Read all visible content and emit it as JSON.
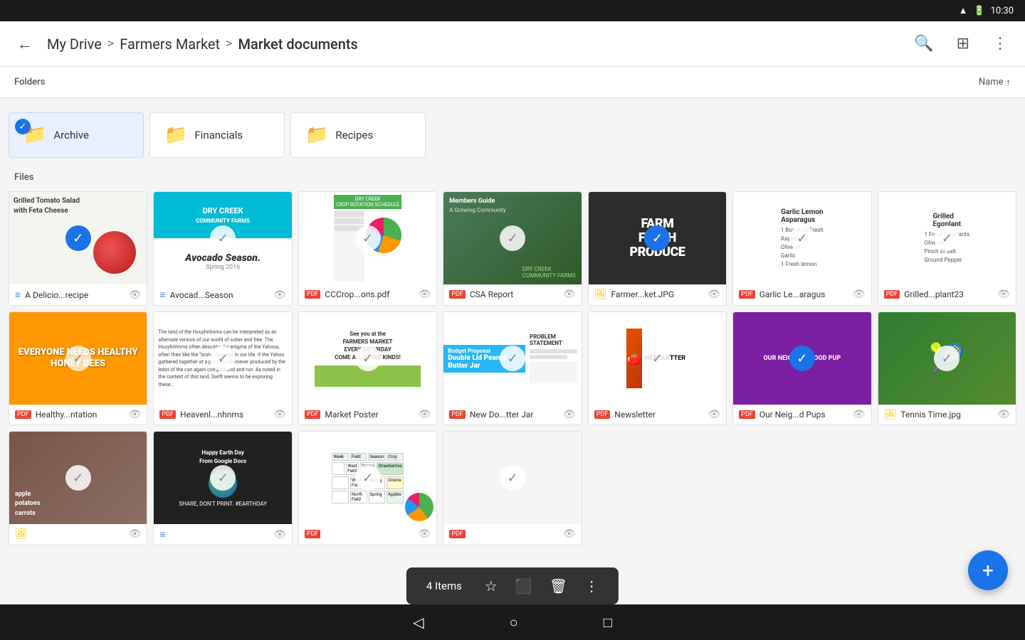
{
  "statusBar": {
    "time": "10:30",
    "wifi": "wifi",
    "battery": "battery"
  },
  "nav": {
    "backLabel": "←",
    "breadcrumb": {
      "part1": "My Drive",
      "sep1": ">",
      "part2": "Farmers Market",
      "sep2": ">",
      "part3": "Market documents"
    },
    "searchIcon": "search",
    "gridIcon": "grid",
    "moreIcon": "⋮"
  },
  "sortBar": {
    "foldersLabel": "Folders",
    "nameLabel": "Name",
    "sortArrow": "↑"
  },
  "folders": [
    {
      "id": "archive",
      "name": "Archive",
      "icon": "📁",
      "color": "#1a73e8",
      "selected": true
    },
    {
      "id": "financials",
      "name": "Financials",
      "icon": "📁",
      "color": "#f9a825",
      "selected": false
    },
    {
      "id": "recipes",
      "name": "Recipes",
      "icon": "📁",
      "color": "#8e24aa",
      "selected": false
    }
  ],
  "filesSection": {
    "label": "Files"
  },
  "files": [
    {
      "id": "file1",
      "name": "A Delicio...recipe",
      "type": "doc",
      "typeLabel": "🟦",
      "checked": true,
      "thumb": "tomato"
    },
    {
      "id": "file2",
      "name": "Avocad...Season",
      "type": "doc",
      "typeLabel": "🟨",
      "checked": false,
      "thumb": "avocado"
    },
    {
      "id": "file3",
      "name": "CCCrop...ons.pdf",
      "type": "pdf",
      "typeLabel": "pdf",
      "checked": false,
      "thumb": "cc"
    },
    {
      "id": "file4",
      "name": "CSA Report",
      "type": "pdf",
      "typeLabel": "pdf",
      "checked": false,
      "thumb": "csa"
    },
    {
      "id": "file5",
      "name": "Farmer...ket.JPG",
      "type": "img",
      "typeLabel": "img",
      "checked": true,
      "thumb": "farm"
    },
    {
      "id": "file6",
      "name": "Garlic Le...aragus",
      "type": "pdf",
      "typeLabel": "pdf",
      "checked": false,
      "thumb": "garlic"
    },
    {
      "id": "file7",
      "name": "Grilled...plant23",
      "type": "pdf",
      "typeLabel": "pdf",
      "checked": false,
      "thumb": "eggplant"
    },
    {
      "id": "file8",
      "name": "Healthy...ntation",
      "type": "pdf",
      "typeLabel": "pdf",
      "checked": false,
      "thumb": "honey"
    },
    {
      "id": "file9",
      "name": "Heavenl...nhnms",
      "type": "pdf",
      "typeLabel": "pdf",
      "checked": false,
      "thumb": "heaven"
    },
    {
      "id": "file10",
      "name": "Market Poster",
      "type": "pdf",
      "typeLabel": "pdf",
      "checked": false,
      "thumb": "market"
    },
    {
      "id": "file11",
      "name": "New Do...tter Jar",
      "type": "pdf",
      "typeLabel": "pdf",
      "checked": false,
      "thumb": "newdo"
    },
    {
      "id": "file12",
      "name": "Newsletter",
      "type": "pdf",
      "typeLabel": "pdf",
      "checked": false,
      "thumb": "newsletter"
    },
    {
      "id": "file13",
      "name": "Our Neig...d Pups",
      "type": "pdf",
      "typeLabel": "pdf",
      "checked": true,
      "thumb": "neigh"
    },
    {
      "id": "file14",
      "name": "Tennis Time.jpg",
      "type": "img",
      "typeLabel": "img",
      "checked": false,
      "thumb": "tennis"
    },
    {
      "id": "file15",
      "name": "",
      "type": "img",
      "typeLabel": "img",
      "checked": false,
      "thumb": "veggies"
    },
    {
      "id": "file16",
      "name": "",
      "type": "doc",
      "typeLabel": "doc",
      "checked": false,
      "thumb": "earth"
    },
    {
      "id": "file17",
      "name": "",
      "type": "pdf",
      "typeLabel": "pdf",
      "checked": false,
      "thumb": "sheet"
    },
    {
      "id": "file18",
      "name": "",
      "type": "pdf",
      "typeLabel": "pdf",
      "checked": false,
      "thumb": "crop"
    }
  ],
  "bottomBar": {
    "itemsCount": "4 Items",
    "starIcon": "☆",
    "moveIcon": "⬛",
    "deleteIcon": "🗑",
    "moreIcon": "⋮"
  },
  "fab": {
    "label": "+"
  },
  "systemNav": {
    "back": "◁",
    "home": "○",
    "recent": "□"
  }
}
